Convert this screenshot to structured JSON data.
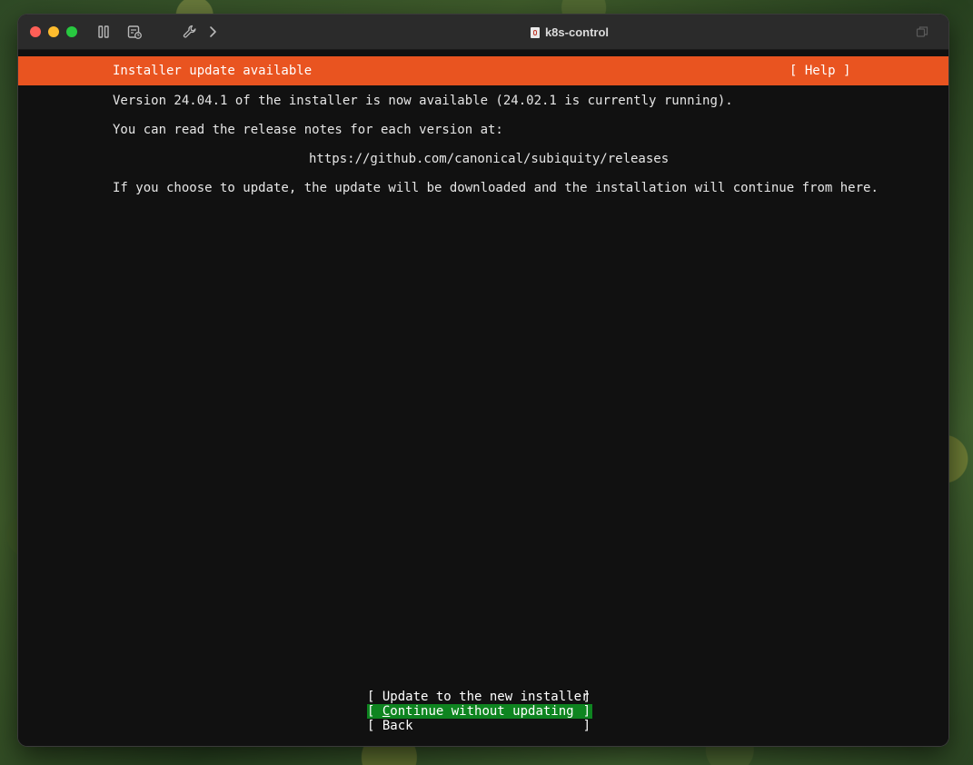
{
  "window": {
    "title": "k8s-control",
    "toolbar_icons": [
      "pause-icon",
      "snapshot-icon",
      "wrench-icon",
      "chevron-right-icon",
      "window-copy-icon"
    ]
  },
  "installer": {
    "header_title": "Installer update available",
    "help_label": "[ Help ]",
    "version_text": "Version 24.04.1 of the installer is now available (24.02.1 is currently running).",
    "notes_text": "You can read the release notes for each version at:",
    "url": "https://github.com/canonical/subiquity/releases",
    "continue_text": "If you choose to update, the update will be downloaded and the installation will continue from here.",
    "buttons": [
      {
        "open": "[ ",
        "label": "Update to the new installer",
        "close": "]",
        "selected": false
      },
      {
        "open": "[ ",
        "first_char": "C",
        "label_rest": "ontinue without updating",
        "close": "]",
        "selected": true
      },
      {
        "open": "[ ",
        "label": "Back",
        "close": "]",
        "selected": false
      }
    ]
  },
  "colors": {
    "header_bg": "#e95420",
    "selected_bg": "#0e8420",
    "terminal_bg": "#111111"
  }
}
